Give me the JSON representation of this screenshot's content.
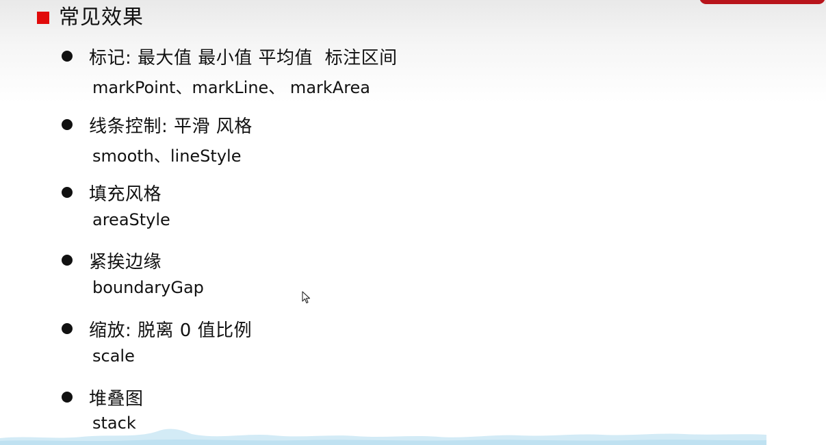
{
  "heading": {
    "title": "常见效果",
    "accent_color": "#e10a0a"
  },
  "items": [
    {
      "label": "标记: 最大值 最小值 平均值  标注区间",
      "code": "markPoint、markLine、 markArea"
    },
    {
      "label": "线条控制: 平滑 风格",
      "code": "smooth、lineStyle"
    },
    {
      "label": "填充风格",
      "code": "areaStyle"
    },
    {
      "label": "紧挨边缘",
      "code": "boundaryGap"
    },
    {
      "label": "缩放: 脱离 0 值比例",
      "code": "scale"
    },
    {
      "label": "堆叠图",
      "code": "stack"
    }
  ],
  "decor": {
    "wave_color": "#cfe8f4",
    "tab_color": "#b8141b",
    "cursor_icon": "mouse-pointer-icon"
  }
}
